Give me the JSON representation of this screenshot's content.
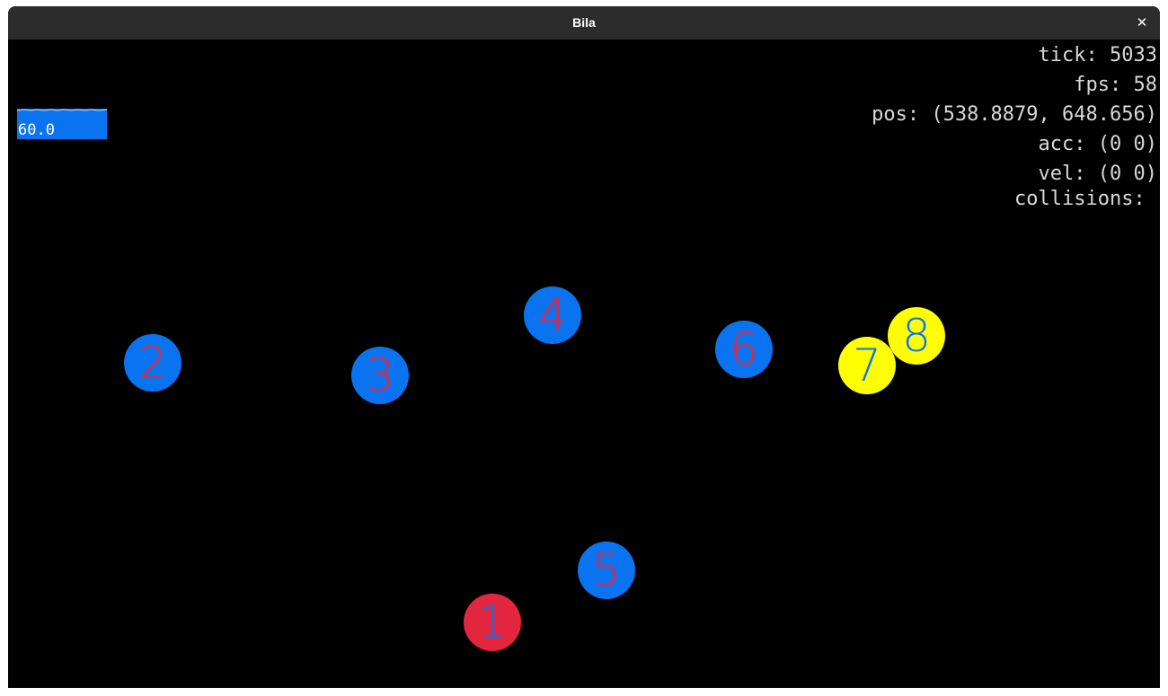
{
  "window": {
    "title": "Bila",
    "close_icon": "close-icon",
    "close_glyph": "✕"
  },
  "fps_graph": {
    "value": "60.0",
    "color": "#0a74f0"
  },
  "hud": {
    "tick": "tick: 5033",
    "fps": "fps: 58",
    "pos": "pos: (538.8879, 648.656)",
    "acc": "acc: (0 0)",
    "vel": "vel: (0 0)",
    "collisions": "collisions: "
  },
  "colors": {
    "background": "#000000",
    "titlebar": "#2c2c2c",
    "blue": "#0a74f0",
    "red": "#e2263d",
    "yellow": "#ffff00"
  },
  "balls": [
    {
      "number": "1",
      "fill": "#e2263d",
      "text_color": "#0a74f0"
    },
    {
      "number": "2",
      "fill": "#0a74f0",
      "text_color": "#e2263d"
    },
    {
      "number": "3",
      "fill": "#0a74f0",
      "text_color": "#e2263d"
    },
    {
      "number": "4",
      "fill": "#0a74f0",
      "text_color": "#e2263d"
    },
    {
      "number": "5",
      "fill": "#0a74f0",
      "text_color": "#e2263d"
    },
    {
      "number": "6",
      "fill": "#0a74f0",
      "text_color": "#e2263d"
    },
    {
      "number": "7",
      "fill": "#ffff00",
      "text_color": "#0a74f0"
    },
    {
      "number": "8",
      "fill": "#ffff00",
      "text_color": "#0a74f0"
    }
  ]
}
